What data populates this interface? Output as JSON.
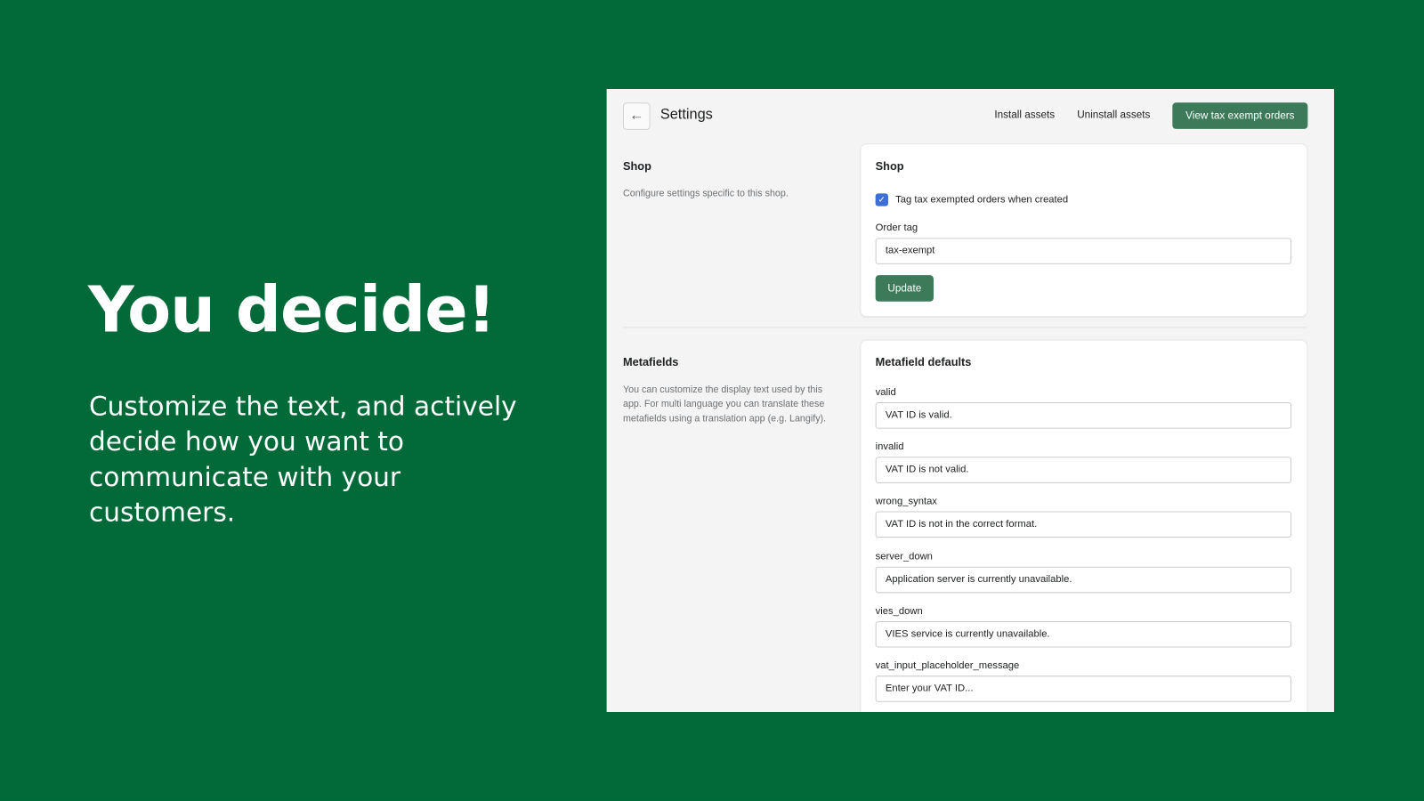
{
  "promo": {
    "headline": "You decide!",
    "subtext": "Customize the text, and actively decide how you want to communicate with your customers."
  },
  "header": {
    "title": "Settings",
    "install_assets": "Install assets",
    "uninstall_assets": "Uninstall assets",
    "view_orders": "View tax exempt orders"
  },
  "shop": {
    "section_title": "Shop",
    "section_desc": "Configure settings specific to this shop.",
    "card_title": "Shop",
    "checkbox_label": "Tag tax exempted orders when created",
    "checkbox_checked": true,
    "order_tag_label": "Order tag",
    "order_tag_value": "tax-exempt",
    "update_label": "Update"
  },
  "metafields": {
    "section_title": "Metafields",
    "section_desc": "You can customize the display text used by this app. For multi language you can translate these metafields using a translation app (e.g. Langify).",
    "card_title": "Metafield defaults",
    "fields": [
      {
        "label": "valid",
        "value": "VAT ID is valid."
      },
      {
        "label": "invalid",
        "value": "VAT ID is not valid."
      },
      {
        "label": "wrong_syntax",
        "value": "VAT ID is not in the correct format."
      },
      {
        "label": "server_down",
        "value": "Application server is currently unavailable."
      },
      {
        "label": "vies_down",
        "value": "VIES service is currently unavailable."
      },
      {
        "label": "vat_input_placeholder_message",
        "value": "Enter your VAT ID..."
      }
    ]
  },
  "colors": {
    "background": "#016a38",
    "primary_button": "#3c7a5a",
    "checkbox": "#3b6fd6"
  }
}
